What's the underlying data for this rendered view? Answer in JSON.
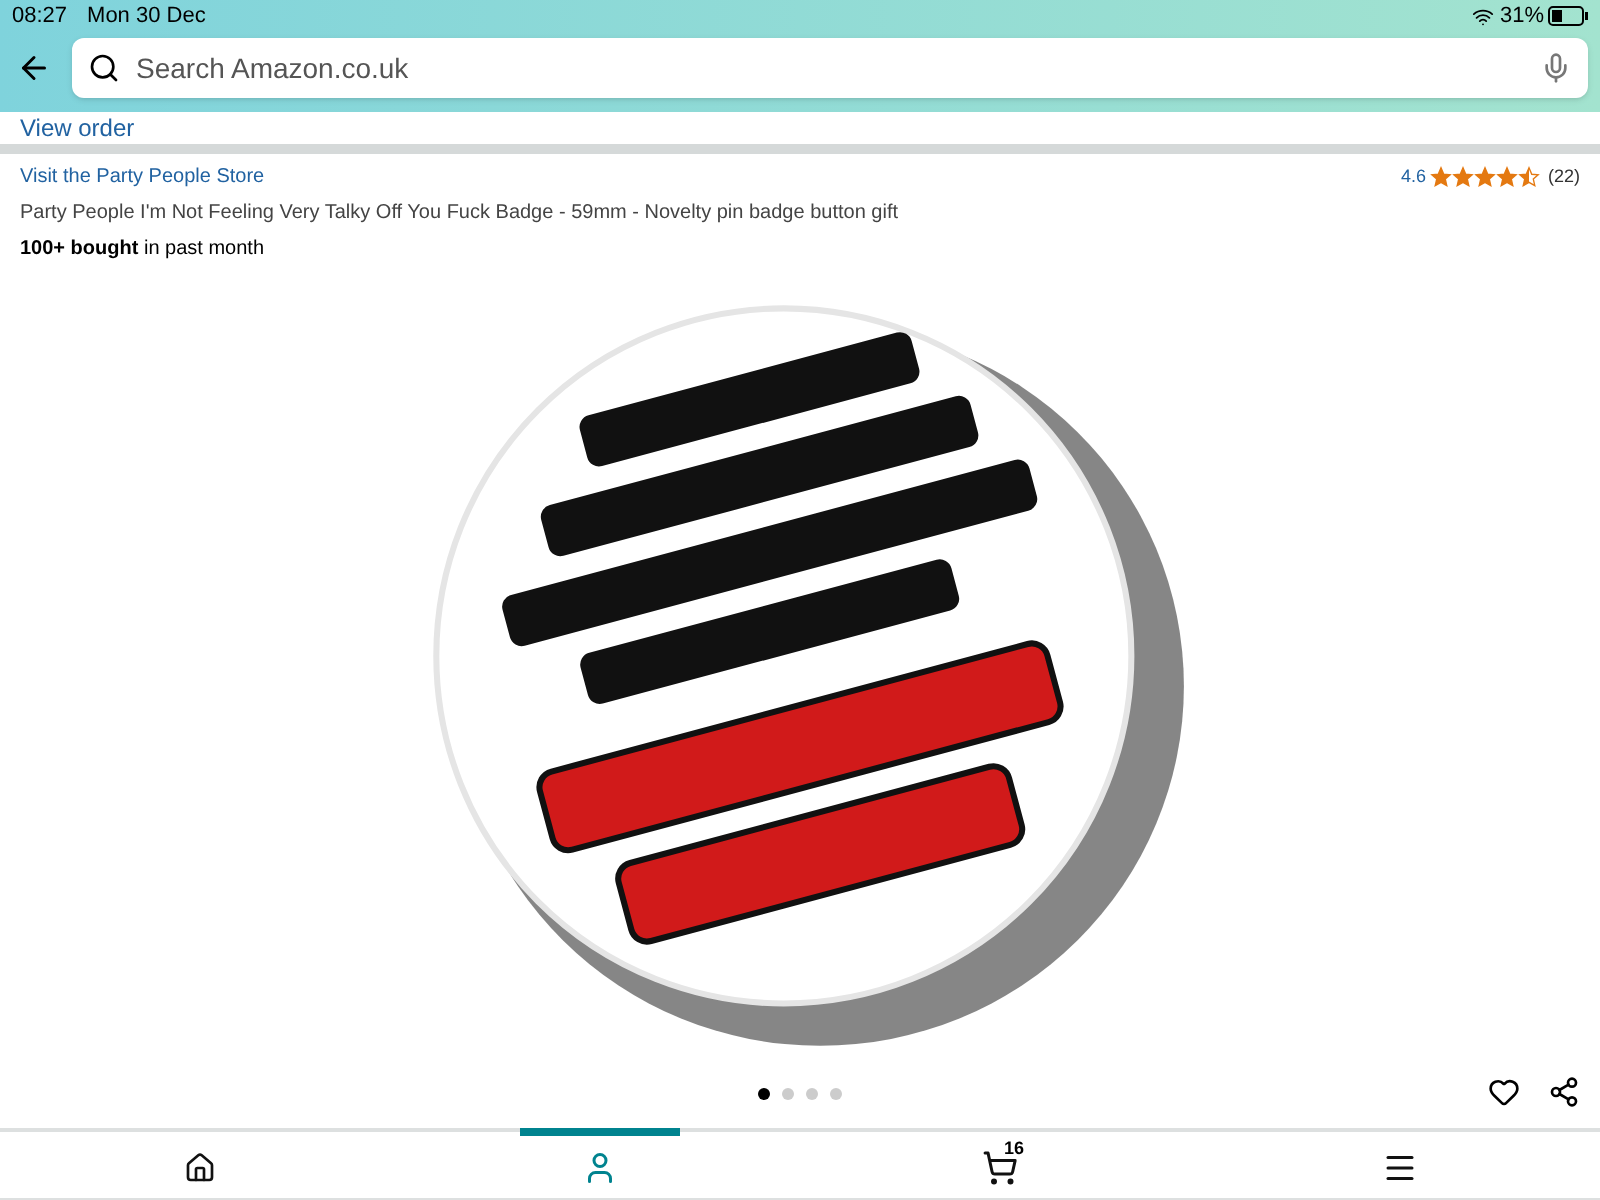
{
  "status_bar": {
    "time": "08:27",
    "date": "Mon 30 Dec",
    "battery": "31%"
  },
  "search": {
    "placeholder": "Search Amazon.co.uk"
  },
  "order_link": "View order",
  "product": {
    "store_link": "Visit the Party People Store",
    "rating": "4.6",
    "stars": 4.5,
    "review_count": "(22)",
    "title": "Party People I'm Not Feeling Very Talky Off You Fuck Badge - 59mm - Novelty pin badge button gift",
    "bought": "**100+ bought** in past month",
    "carousel": [
      {
        "selected": true
      },
      {
        "selected": false
      },
      {
        "selected": false
      },
      {
        "selected": false
      }
    ]
  },
  "bottom_nav": [
    {
      "kind": "home",
      "selected": false
    },
    {
      "kind": "account",
      "selected": true
    },
    {
      "kind": "cart",
      "selected": false,
      "count": "16"
    },
    {
      "kind": "menu",
      "selected": false
    }
  ]
}
